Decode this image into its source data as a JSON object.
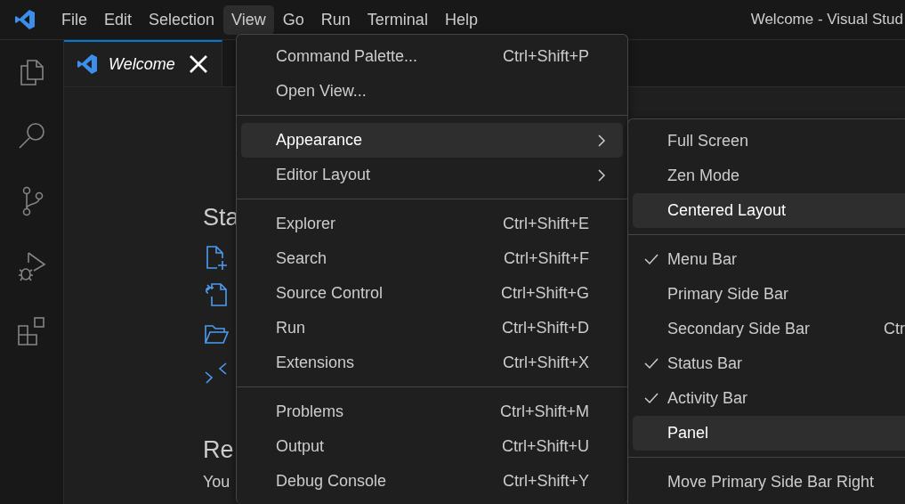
{
  "title_bar": {
    "menus": [
      {
        "label": "File",
        "selected": false
      },
      {
        "label": "Edit",
        "selected": false
      },
      {
        "label": "Selection",
        "selected": false
      },
      {
        "label": "View",
        "selected": true
      },
      {
        "label": "Go",
        "selected": false
      },
      {
        "label": "Run",
        "selected": false
      },
      {
        "label": "Terminal",
        "selected": false
      },
      {
        "label": "Help",
        "selected": false
      }
    ],
    "title": "Welcome - Visual Stud"
  },
  "tabs": [
    {
      "label": "Welcome",
      "selected": true
    }
  ],
  "welcome": {
    "start_heading": "Sta",
    "recent_heading": "Re",
    "recent_text": "You"
  },
  "view_menu": {
    "items": [
      {
        "kind": "item",
        "label": "Command Palette...",
        "shortcut": "Ctrl+Shift+P",
        "highlighted": false
      },
      {
        "kind": "item",
        "label": "Open View...",
        "highlighted": false
      },
      {
        "kind": "separator"
      },
      {
        "kind": "submenu",
        "label": "Appearance",
        "highlighted": true
      },
      {
        "kind": "submenu",
        "label": "Editor Layout",
        "highlighted": false
      },
      {
        "kind": "separator"
      },
      {
        "kind": "item",
        "label": "Explorer",
        "shortcut": "Ctrl+Shift+E",
        "highlighted": false
      },
      {
        "kind": "item",
        "label": "Search",
        "shortcut": "Ctrl+Shift+F",
        "highlighted": false
      },
      {
        "kind": "item",
        "label": "Source Control",
        "shortcut": "Ctrl+Shift+G",
        "highlighted": false
      },
      {
        "kind": "item",
        "label": "Run",
        "shortcut": "Ctrl+Shift+D",
        "highlighted": false
      },
      {
        "kind": "item",
        "label": "Extensions",
        "shortcut": "Ctrl+Shift+X",
        "highlighted": false
      },
      {
        "kind": "separator"
      },
      {
        "kind": "item",
        "label": "Problems",
        "shortcut": "Ctrl+Shift+M",
        "highlighted": false
      },
      {
        "kind": "item",
        "label": "Output",
        "shortcut": "Ctrl+Shift+U",
        "highlighted": false
      },
      {
        "kind": "item",
        "label": "Debug Console",
        "shortcut": "Ctrl+Shift+Y",
        "highlighted": false
      }
    ]
  },
  "appearance_submenu": {
    "items": [
      {
        "kind": "item",
        "label": "Full Screen",
        "checked": false,
        "highlighted": false
      },
      {
        "kind": "item",
        "label": "Zen Mode",
        "checked": false,
        "highlighted": false
      },
      {
        "kind": "item",
        "label": "Centered Layout",
        "checked": false,
        "highlighted": true
      },
      {
        "kind": "separator"
      },
      {
        "kind": "item",
        "label": "Menu Bar",
        "checked": true,
        "highlighted": false
      },
      {
        "kind": "item",
        "label": "Primary Side Bar",
        "checked": false,
        "highlighted": false
      },
      {
        "kind": "item",
        "label": "Secondary Side Bar",
        "shortcut": "Ctr",
        "checked": false,
        "highlighted": false
      },
      {
        "kind": "item",
        "label": "Status Bar",
        "checked": true,
        "highlighted": false
      },
      {
        "kind": "item",
        "label": "Activity Bar",
        "checked": true,
        "highlighted": false
      },
      {
        "kind": "item",
        "label": "Panel",
        "checked": false,
        "highlighted": true
      },
      {
        "kind": "separator"
      },
      {
        "kind": "item",
        "label": "Move Primary Side Bar Right",
        "checked": false,
        "highlighted": false
      }
    ]
  }
}
